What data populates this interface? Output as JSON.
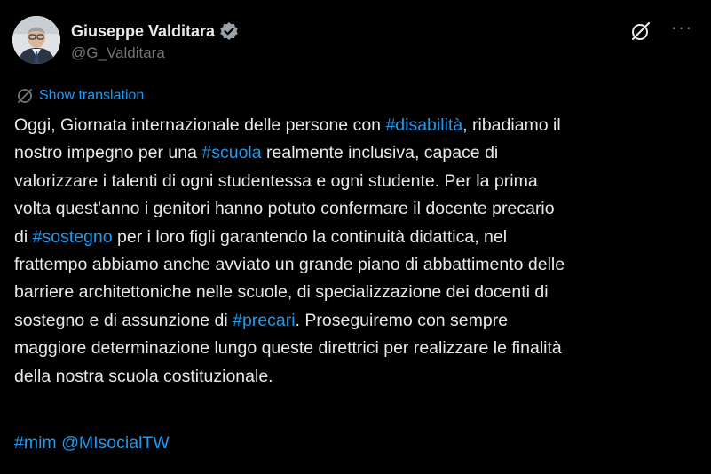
{
  "author": {
    "display_name": "Giuseppe Valditara",
    "handle": "@G_Valditara"
  },
  "actions": {
    "translate_label": "Show translation",
    "more_label": "···"
  },
  "body": {
    "lines": [
      [
        {
          "t": "Oggi, Giornata internazionale delle persone con "
        },
        {
          "t": "#disabilità",
          "tag": true
        },
        {
          "t": ", ribadiamo il"
        }
      ],
      [
        {
          "t": "nostro impegno per una "
        },
        {
          "t": "#scuola",
          "tag": true
        },
        {
          "t": " realmente inclusiva, capace di"
        }
      ],
      [
        {
          "t": "valorizzare  i talenti di ogni studentessa e ogni studente. Per la prima"
        }
      ],
      [
        {
          "t": "volta quest'anno i genitori hanno potuto confermare il docente precario"
        }
      ],
      [
        {
          "t": "di "
        },
        {
          "t": "#sostegno",
          "tag": true
        },
        {
          "t": " per i loro figli garantendo la continuità didattica, nel"
        }
      ],
      [
        {
          "t": "frattempo abbiamo anche avviato un grande piano di abbattimento delle"
        }
      ],
      [
        {
          "t": "barriere architettoniche nelle scuole,  di specializzazione dei docenti di"
        }
      ],
      [
        {
          "t": "sostegno e di assunzione di "
        },
        {
          "t": "#precari",
          "tag": true
        },
        {
          "t": ". Proseguiremo con sempre"
        }
      ],
      [
        {
          "t": "maggiore determinazione lungo queste direttrici per realizzare le finalità"
        }
      ],
      [
        {
          "t": "della nostra scuola costituzionale."
        }
      ]
    ],
    "footer_tags": [
      "#mim",
      "@MIsocialTW"
    ]
  },
  "colors": {
    "background": "#000000",
    "text": "#e7e9ea",
    "muted": "#71767b",
    "link": "#1d9bf0"
  }
}
